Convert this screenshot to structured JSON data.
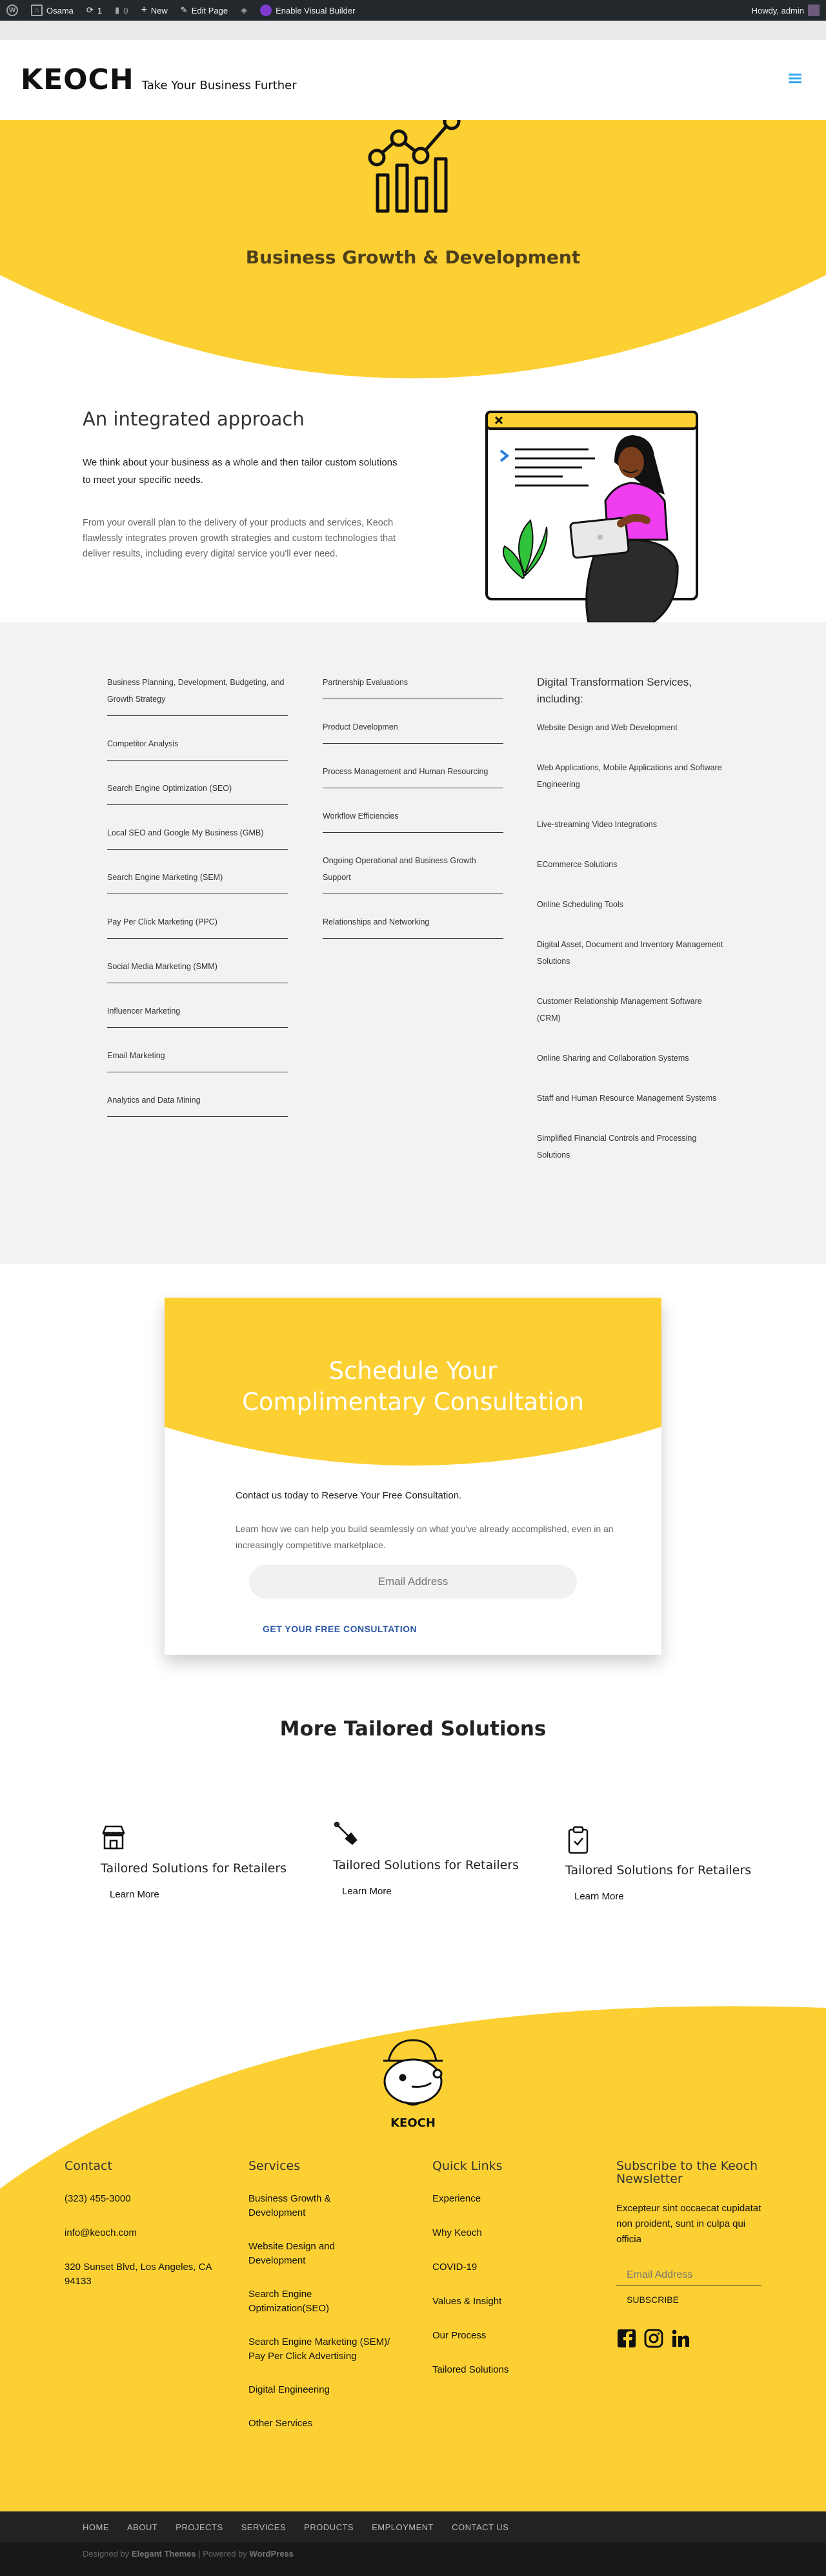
{
  "adminbar": {
    "user_site": "Osama",
    "comments_count": "1",
    "pending_count": "0",
    "new_label": "New",
    "edit_page_label": "Edit Page",
    "visual_builder_label": "Enable Visual Builder",
    "howdy_label": "Howdy, admin"
  },
  "header": {
    "brand": "KEOCH",
    "tagline": "Take Your Business Further"
  },
  "hero": {
    "title": "Business Growth & Development"
  },
  "approach": {
    "heading": "An integrated approach",
    "paragraph1": "We think about your business as a whole and then tailor custom solutions to meet your specific needs.",
    "paragraph2": "From your overall plan to the delivery of your products and services, Keoch flawlessly integrates proven growth strategies and custom technologies that deliver results, including every digital service you'll ever need."
  },
  "services": {
    "column1": [
      "Business Planning, Development, Budgeting, and Growth Strategy",
      "Competitor Analysis",
      "Search Engine Optimization (SEO)",
      "Local SEO and Google My Business (GMB)",
      "Search Engine Marketing (SEM)",
      "Pay Per Click Marketing (PPC)",
      "Social Media Marketing (SMM)",
      "Influencer Marketing",
      "Email Marketing",
      "Analytics and Data Mining"
    ],
    "column2": [
      "Partnership Evaluations",
      "Product Developmen",
      "Process Management and Human Resourcing",
      "Workflow Efficiencies",
      "Ongoing Operational and Business Growth Support",
      "Relationships and Networking"
    ],
    "column3_heading": "Digital Transformation Services, including:",
    "column3": [
      "Website Design and Web Development",
      "Web Applications, Mobile Applications and Software Engineering",
      "Live-streaming Video Integrations",
      "ECommerce Solutions",
      "Online Scheduling Tools",
      "Digital Asset, Document and Inventory Management Solutions",
      "Customer Relationship Management Software (CRM)",
      "Online Sharing and Collaboration Systems",
      "Staff and Human Resource Management Systems",
      "Simplified Financial Controls and Processing Solutions"
    ]
  },
  "consult": {
    "title_line1": "Schedule Your",
    "title_line2": "Complimentary Consultation",
    "intro": "Contact us today to Reserve Your Free Consultation.",
    "body": "Learn how we can help you build seamlessly on what you've already accomplished, even in an increasingly competitive marketplace.",
    "email_placeholder": "Email Address",
    "cta": "GET YOUR FREE CONSULTATION"
  },
  "tailored": {
    "title": "More Tailored Solutions",
    "cards": [
      {
        "title": "Tailored Solutions for Retailers",
        "link": "Learn More",
        "icon": "store-icon"
      },
      {
        "title": "Tailored Solutions for Retailers",
        "link": "Learn More",
        "icon": "pen-tool-icon"
      },
      {
        "title": "Tailored Solutions for Retailers",
        "link": "Learn More",
        "icon": "clipboard-icon"
      }
    ]
  },
  "footer": {
    "logo_text": "KEOCH",
    "contact_heading": "Contact",
    "phone": "(323) 455-3000",
    "email": "info@keoch.com",
    "address": "320 Sunset Blvd, Los Angeles, CA 94133",
    "services_heading": "Services",
    "services": [
      "Business Growth & Development",
      "Website Design and Development",
      "Search Engine Optimization(SEO)",
      "Search Engine Marketing (SEM)/ Pay Per Click Advertising",
      "Digital Engineering",
      "Other Services"
    ],
    "quicklinks_heading": "Quick Links",
    "quicklinks": [
      "Experience",
      "Why Keoch",
      "COVID-19",
      "Values & Insight",
      "Our Process",
      "Tailored Solutions"
    ],
    "newsletter_heading": "Subscribe to the Keoch Newsletter",
    "newsletter_desc": "Excepteur sint occaecat cupidatat non proident, sunt in culpa qui officia",
    "newsletter_placeholder": "Email Address",
    "subscribe_label": "SUBSCRIBE"
  },
  "bottomnav": [
    "HOME",
    "ABOUT",
    "PROJECTS",
    "SERVICES",
    "PRODUCTS",
    "EMPLOYMENT",
    "CONTACT US"
  ],
  "credits": {
    "designed_by": "Designed by",
    "elegant": "Elegant Themes",
    "powered_by": "| Powered by",
    "wordpress": "WordPress"
  },
  "colors": {
    "accent_yellow": "#fcd033",
    "link_blue": "#2b57a7",
    "menu_blue": "#2ea3f2",
    "admin_bar": "#23282d"
  }
}
